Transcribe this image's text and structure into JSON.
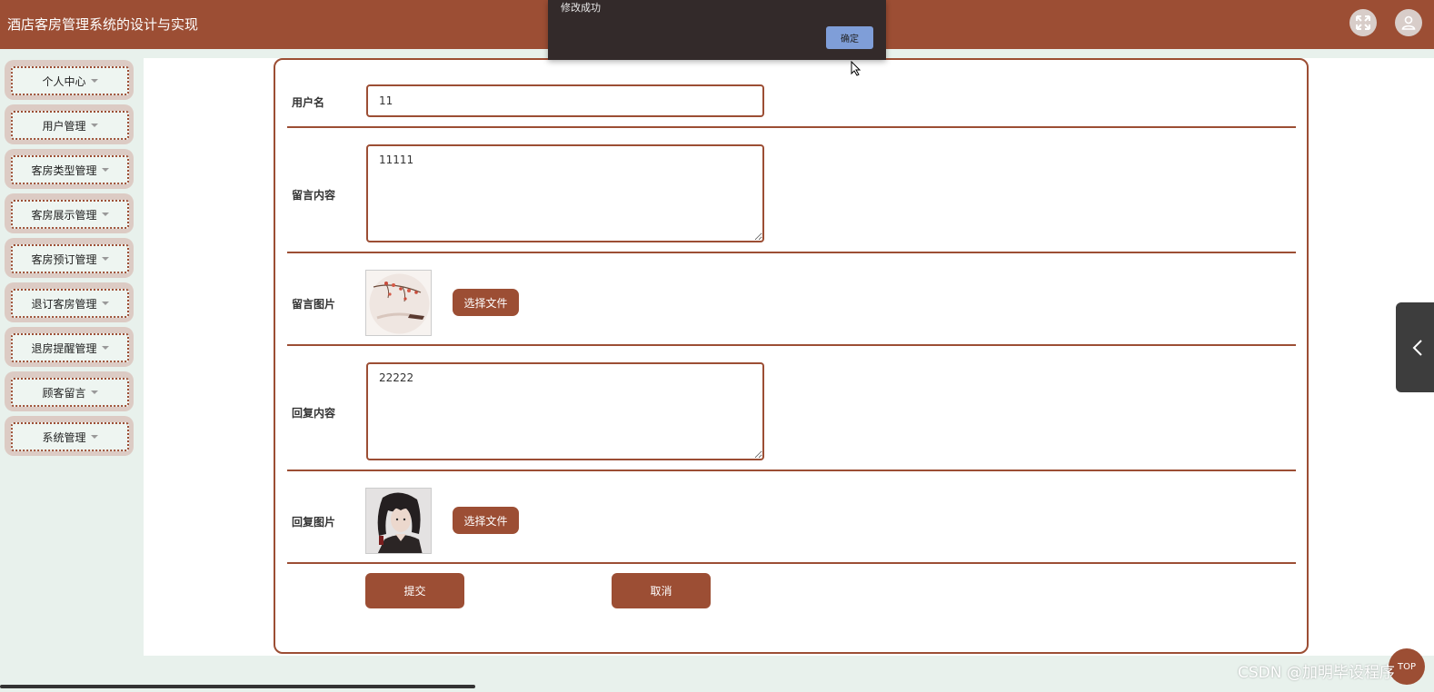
{
  "header": {
    "title": "酒店客房管理系统的设计与实现",
    "fullscreen_icon": "fullscreen-icon",
    "user_icon": "user-icon"
  },
  "sidebar": {
    "items": [
      {
        "label": "个人中心"
      },
      {
        "label": "用户管理"
      },
      {
        "label": "客房类型管理"
      },
      {
        "label": "客房展示管理"
      },
      {
        "label": "客房预订管理"
      },
      {
        "label": "退订客房管理"
      },
      {
        "label": "退房提醒管理"
      },
      {
        "label": "顾客留言"
      },
      {
        "label": "系统管理"
      }
    ]
  },
  "form": {
    "username_label": "用户名",
    "username_value": "11",
    "message_label": "留言内容",
    "message_value": "11111",
    "message_image_label": "留言图片",
    "reply_label": "回复内容",
    "reply_value": "22222",
    "reply_image_label": "回复图片",
    "choose_file_label": "选择文件",
    "submit_label": "提交",
    "cancel_label": "取消"
  },
  "toast": {
    "message": "修改成功",
    "confirm_label": "确定"
  },
  "floating": {
    "top_label": "TOP",
    "watermark": "CSDN @加明毕设程序"
  },
  "colors": {
    "primary": "#9c4e34",
    "background": "#e8f1ec",
    "toast_bg": "#332a2a",
    "toast_button": "#7f9ed8"
  }
}
